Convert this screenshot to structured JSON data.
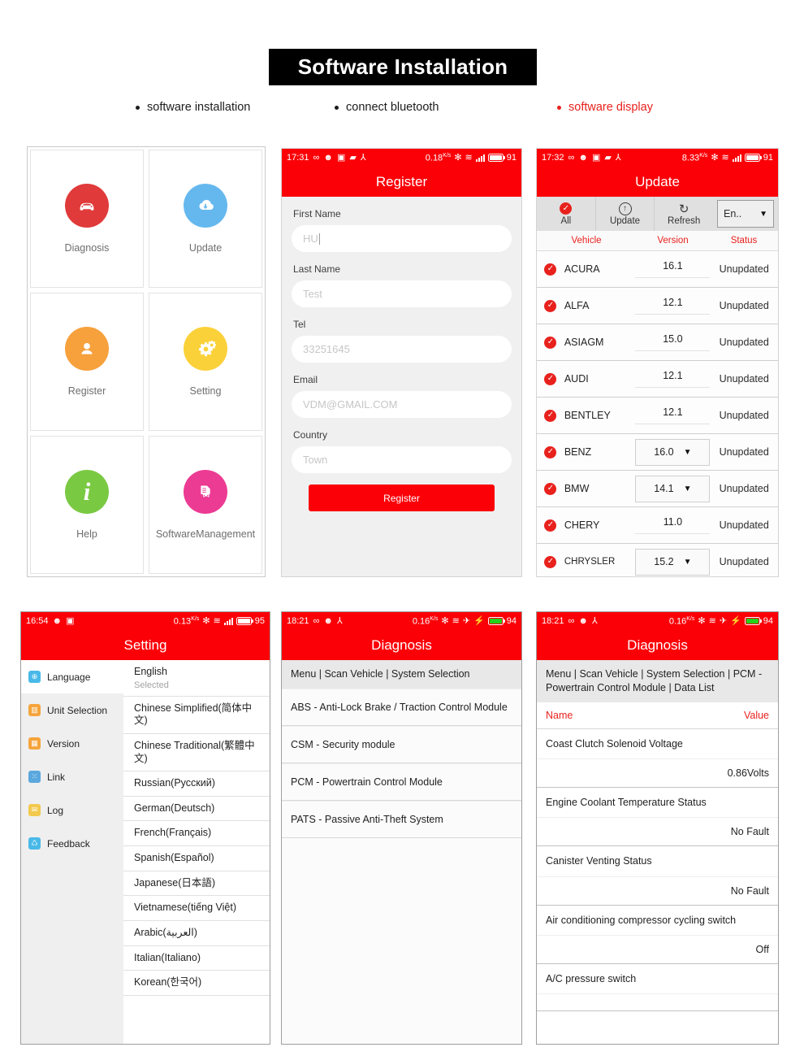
{
  "header": {
    "title": "Software Installation"
  },
  "captions": [
    {
      "text": "software installation",
      "highlight": false
    },
    {
      "text": "connect bluetooth",
      "highlight": false
    },
    {
      "text": "software display",
      "highlight": true
    }
  ],
  "colors": {
    "brand_red": "#fb0007",
    "accent_red": "#e8211d",
    "diagnosis_icon": "#e03a3a",
    "update_icon": "#65b8ee",
    "register_icon": "#f6a13c",
    "setting_icon": "#fbd13a",
    "help_icon": "#7ac943",
    "software_mgmt_icon": "#ec3b93"
  },
  "home": {
    "items": [
      {
        "label": "Diagnosis",
        "icon": "car-icon",
        "color": "#e03a3a",
        "glyph": "✈"
      },
      {
        "label": "Update",
        "icon": "cloud-download-icon",
        "color": "#65b8ee",
        "glyph": "↓"
      },
      {
        "label": "Register",
        "icon": "user-icon",
        "color": "#f6a13c",
        "glyph": "●"
      },
      {
        "label": "Setting",
        "icon": "gear-icon",
        "color": "#fbd13a",
        "glyph": "⚙"
      },
      {
        "label": "Help",
        "icon": "info-icon",
        "color": "#7ac943",
        "glyph": "i"
      },
      {
        "label": "SoftwareManagement",
        "icon": "document-car-icon",
        "color": "#ec3b93",
        "glyph": "☷"
      }
    ]
  },
  "register": {
    "statusbar": {
      "time": "17:31",
      "rate": "0.18",
      "rate_unit": "K/s",
      "battery": "91",
      "icons": [
        "infinity-icon",
        "emoji-icon",
        "image-icon",
        "video-icon",
        "share-icon",
        "bluetooth-icon",
        "wifi-icon",
        "signal-icon",
        "battery-icon"
      ]
    },
    "title": "Register",
    "fields": [
      {
        "label": "First Name",
        "value": "HU",
        "placeholder": "HU"
      },
      {
        "label": "Last Name",
        "value": "Test",
        "placeholder": "Test"
      },
      {
        "label": "Tel",
        "value": "33251645",
        "placeholder": "33251645"
      },
      {
        "label": "Email",
        "value": "VDM@GMAIL.COM",
        "placeholder": "VDM@GMAIL.COM"
      },
      {
        "label": "Country",
        "value": "Town",
        "placeholder": "Town"
      }
    ],
    "submit_label": "Register"
  },
  "update": {
    "statusbar": {
      "time": "17:32",
      "rate": "8.33",
      "rate_unit": "K/s",
      "battery": "91"
    },
    "title": "Update",
    "toolbar": [
      {
        "label": "All",
        "icon": "check-circle-icon"
      },
      {
        "label": "Update",
        "icon": "upload-circle-icon"
      },
      {
        "label": "Refresh",
        "icon": "refresh-icon"
      }
    ],
    "language_selector": "En..",
    "columns": [
      "Vehicle",
      "Version",
      "Status"
    ],
    "rows": [
      {
        "vehicle": "ACURA",
        "version": "16.1",
        "status": "Unupdated",
        "dropdown": false
      },
      {
        "vehicle": "ALFA",
        "version": "12.1",
        "status": "Unupdated",
        "dropdown": false
      },
      {
        "vehicle": "ASIAGM",
        "version": "15.0",
        "status": "Unupdated",
        "dropdown": false
      },
      {
        "vehicle": "AUDI",
        "version": "12.1",
        "status": "Unupdated",
        "dropdown": false
      },
      {
        "vehicle": "BENTLEY",
        "version": "12.1",
        "status": "Unupdated",
        "dropdown": false
      },
      {
        "vehicle": "BENZ",
        "version": "16.0",
        "status": "Unupdated",
        "dropdown": true
      },
      {
        "vehicle": "BMW",
        "version": "14.1",
        "status": "Unupdated",
        "dropdown": true
      },
      {
        "vehicle": "CHERY",
        "version": "11.0",
        "status": "Unupdated",
        "dropdown": false
      },
      {
        "vehicle": "CHRYSLER",
        "version": "15.2",
        "status": "Unupdated",
        "dropdown": true
      }
    ]
  },
  "setting": {
    "statusbar": {
      "time": "16:54",
      "rate": "0.13",
      "rate_unit": "K/s",
      "battery": "95"
    },
    "title": "Setting",
    "menu": [
      {
        "label": "Language",
        "icon": "globe-icon",
        "color": "#49b9e8",
        "active": true
      },
      {
        "label": "Unit Selection",
        "icon": "chart-icon",
        "color": "#f5a43c",
        "active": false
      },
      {
        "label": "Version",
        "icon": "grid-icon",
        "color": "#f5a43c",
        "active": false
      },
      {
        "label": "Link",
        "icon": "link-icon",
        "color": "#5aa8dd",
        "active": false
      },
      {
        "label": "Log",
        "icon": "mail-icon",
        "color": "#f2c94c",
        "active": false
      },
      {
        "label": "Feedback",
        "icon": "feedback-icon",
        "color": "#49b9e8",
        "active": false
      }
    ],
    "selected_language": "English",
    "selected_state": "Selected",
    "languages": [
      "Chinese Simplified(简体中文)",
      "Chinese Traditional(繁體中文)",
      "Russian(Русский)",
      "German(Deutsch)",
      "French(Français)",
      "Spanish(Español)",
      "Japanese(日本語)",
      "Vietnamese(tiếng Việt)",
      "Arabic(العربية)",
      "Italian(Italiano)",
      "Korean(한국어)"
    ]
  },
  "diagnosis": {
    "statusbar": {
      "time": "18:21",
      "rate": "0.16",
      "rate_unit": "K/s",
      "battery": "94"
    },
    "title": "Diagnosis",
    "breadcrumb": "Menu | Scan Vehicle | System Selection",
    "items": [
      "ABS - Anti-Lock Brake / Traction Control Module",
      "CSM - Security module",
      "PCM - Powertrain Control Module",
      "PATS - Passive Anti-Theft System"
    ]
  },
  "datalist": {
    "statusbar": {
      "time": "18:21",
      "rate": "0.16",
      "rate_unit": "K/s",
      "battery": "94"
    },
    "title": "Diagnosis",
    "breadcrumb": "Menu | Scan Vehicle | System Selection | PCM - Powertrain Control Module | Data List",
    "columns": {
      "name": "Name",
      "value": "Value"
    },
    "rows": [
      {
        "name": "Coast Clutch Solenoid Voltage",
        "value": "0.86Volts"
      },
      {
        "name": "Engine Coolant Temperature Status",
        "value": "No Fault"
      },
      {
        "name": "Canister Venting Status",
        "value": "No Fault"
      },
      {
        "name": "Air conditioning compressor cycling switch",
        "value": "Off"
      },
      {
        "name": "A/C pressure switch",
        "value": ""
      }
    ]
  }
}
